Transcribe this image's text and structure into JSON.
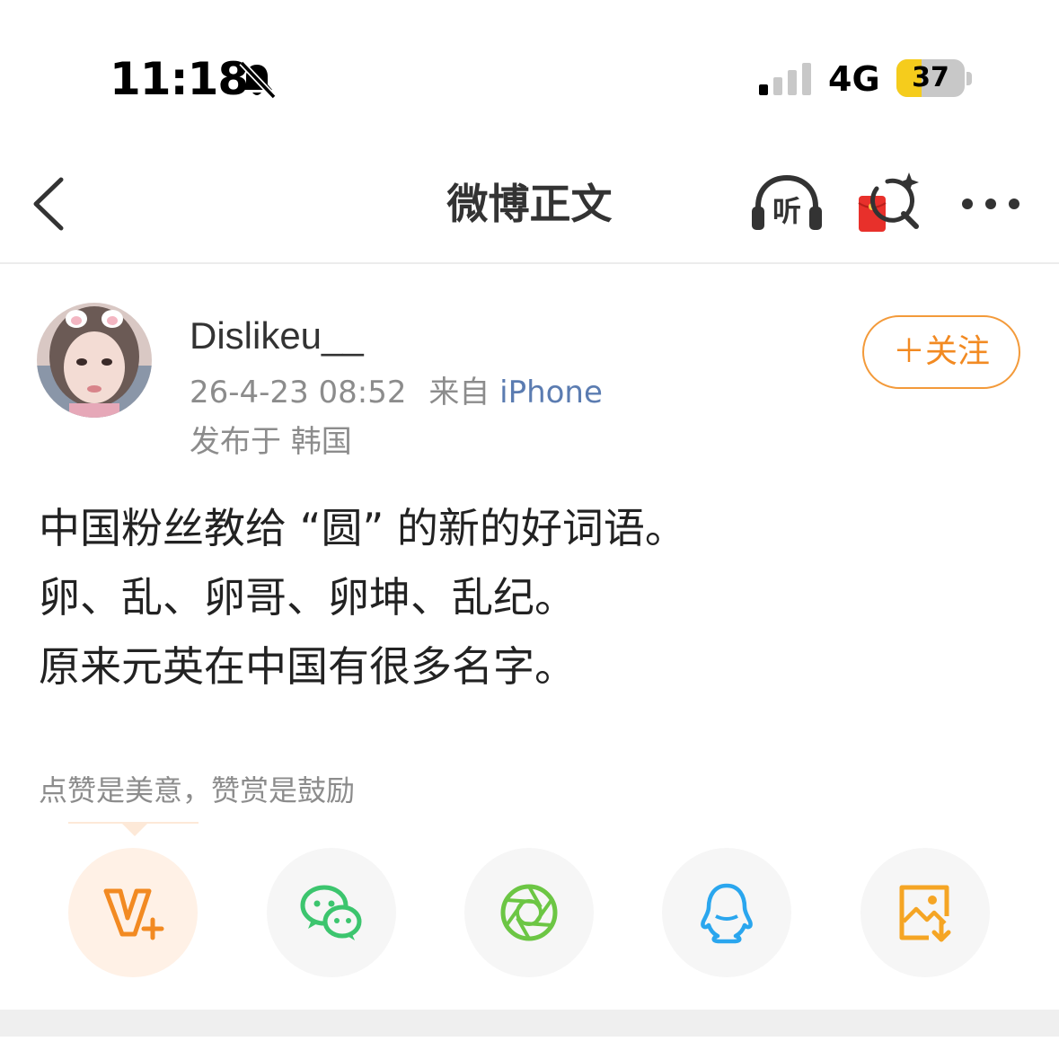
{
  "status_bar": {
    "time": "11:18",
    "network": "4G",
    "battery": "37",
    "battery_level": 0.37,
    "icons": [
      "bell-muted-icon",
      "signal-icon"
    ]
  },
  "nav": {
    "title": "微博正文",
    "listen_label": "听",
    "icons": [
      "back-arrow-icon",
      "listen-headphones-icon",
      "red-packet-search-icon",
      "more-dots-icon"
    ]
  },
  "post": {
    "username": "Dislikeu__",
    "time": "26-4-23 08:52",
    "source_prefix": "来自",
    "source": "iPhone",
    "location": "发布于 韩国",
    "follow_label": "＋关注",
    "content_lines": [
      "中国粉丝教给 “圆” 的新的好词语。",
      "卵、乱、卵哥、卵坤、乱纪。",
      "原来元英在中国有很多名字。"
    ]
  },
  "reward": {
    "tip": "点赞是美意，赞赏是鼓励"
  },
  "share": {
    "buttons": [
      "reward-v-plus-icon",
      "wechat-icon",
      "moments-icon",
      "qq-icon",
      "save-image-icon"
    ]
  },
  "colors": {
    "accent_orange": "#f28a22",
    "link_blue": "#5b7cb1",
    "wechat_green": "#3cc56e",
    "moments_green": "#6cc644",
    "qq_blue": "#2aa6ee",
    "battery_yellow": "#f5cc1c"
  }
}
